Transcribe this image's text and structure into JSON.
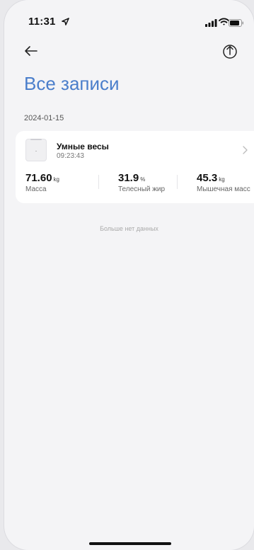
{
  "status_bar": {
    "time": "11:31"
  },
  "header": {
    "title": "Все записи"
  },
  "records": {
    "date": "2024-01-15",
    "device_name": "Умные весы",
    "device_time": "09:23:43",
    "metrics": [
      {
        "value": "71.60",
        "unit": "kg",
        "label": "Масса"
      },
      {
        "value": "31.9",
        "unit": "%",
        "label": "Телесный жир"
      },
      {
        "value": "45.3",
        "unit": "kg",
        "label": "Мышечная масс"
      }
    ]
  },
  "footer_note": "Больше нет данных",
  "icons": {
    "back": "arrow-left-icon",
    "share": "share-upload-icon",
    "chevron": "chevron-right-icon"
  },
  "colors": {
    "title": "#4a7ecb",
    "background": "#f4f4f6",
    "card": "#ffffff"
  }
}
